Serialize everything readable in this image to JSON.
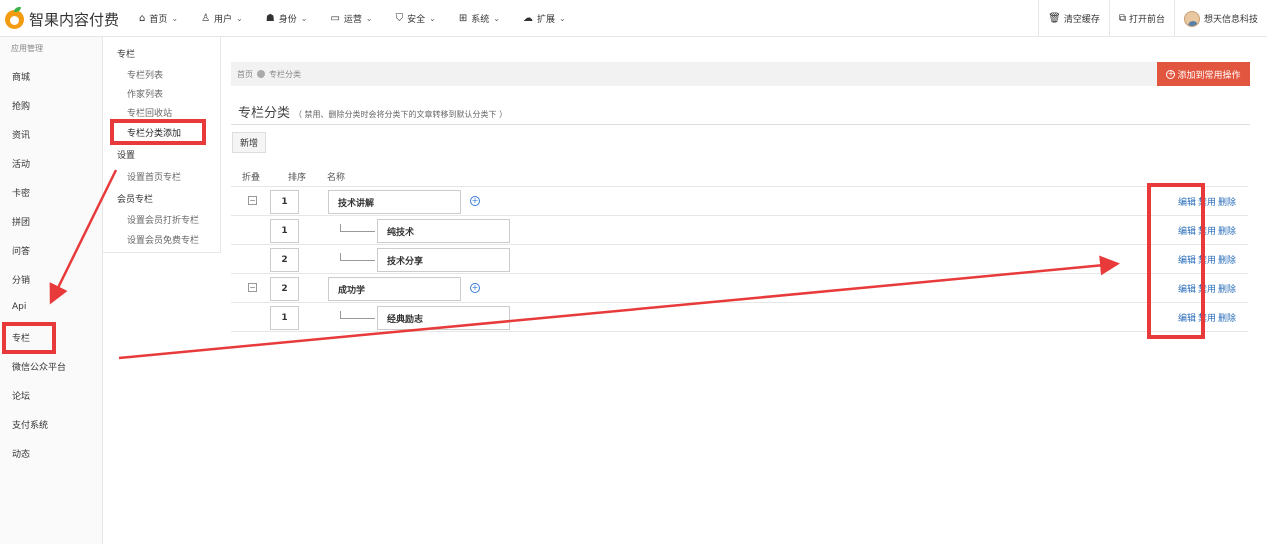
{
  "app": {
    "title": "智果内容付费"
  },
  "nav": [
    {
      "icon": "home-icon",
      "label": "首页"
    },
    {
      "icon": "user-icon",
      "label": "用户"
    },
    {
      "icon": "users-icon",
      "label": "身份"
    },
    {
      "icon": "monitor-icon",
      "label": "运营"
    },
    {
      "icon": "shield-icon",
      "label": "安全"
    },
    {
      "icon": "windows-icon",
      "label": "系统"
    },
    {
      "icon": "cloud-icon",
      "label": "扩展"
    }
  ],
  "tools": {
    "clear_cache": "清空缓存",
    "open_frontend": "打开前台",
    "user_name": "想天信息科技"
  },
  "sidebar": {
    "heading": "应用管理",
    "items": [
      "商城",
      "抢购",
      "资讯",
      "活动",
      "卡密",
      "拼团",
      "问答",
      "分销",
      "Api",
      "专栏",
      "微信公众平台",
      "论坛",
      "支付系统",
      "动态"
    ]
  },
  "subnav": {
    "groups": [
      {
        "title": "专栏",
        "items": [
          "专栏列表",
          "作家列表",
          "专栏回收站",
          "专栏分类添加"
        ]
      },
      {
        "title": "设置",
        "items": [
          "设置首页专栏"
        ]
      },
      {
        "title": "会员专栏",
        "items": [
          "设置会员打折专栏",
          "设置会员免费专栏"
        ]
      }
    ]
  },
  "breadcrumb": {
    "home": "首页",
    "current": "专栏分类"
  },
  "add_common": "添加到常用操作",
  "page": {
    "title": "专栏分类",
    "note": "（ 禁用、删除分类时会将分类下的文章转移到默认分类下 ）"
  },
  "new_button": "新增",
  "table": {
    "headers": {
      "fold": "折叠",
      "sort": "排序",
      "name": "名称"
    },
    "rows": [
      {
        "level": 0,
        "sort": "1",
        "name": "技术讲解"
      },
      {
        "level": 1,
        "sort": "1",
        "name": "纯技术"
      },
      {
        "level": 1,
        "sort": "2",
        "name": "技术分享"
      },
      {
        "level": 0,
        "sort": "2",
        "name": "成功学"
      },
      {
        "level": 1,
        "sort": "1",
        "name": "经典励志"
      }
    ],
    "ops": {
      "edit": "编辑",
      "disable": "禁用",
      "delete": "删除"
    }
  },
  "colors": {
    "accent_red": "#e2553e",
    "annotation_red": "#e83a3a",
    "link_blue": "#2a6ebb"
  }
}
